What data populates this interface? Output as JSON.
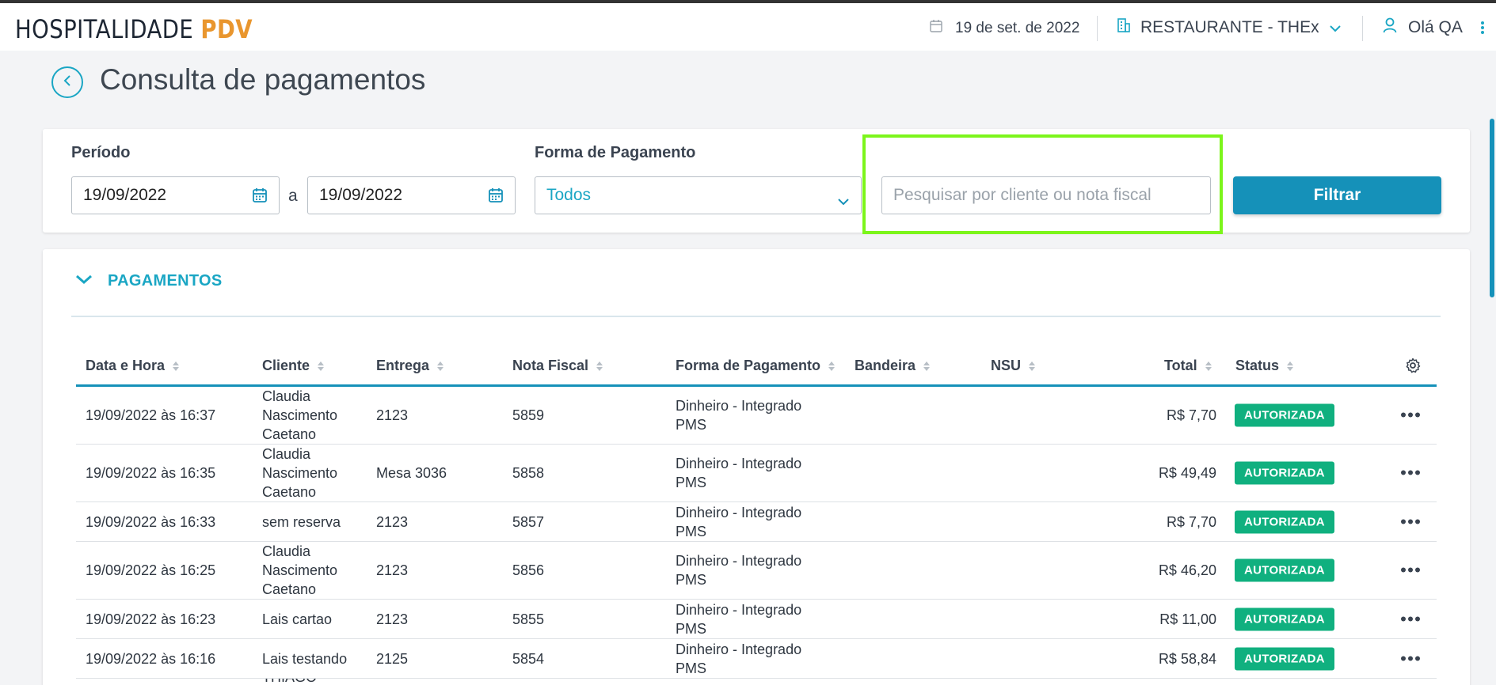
{
  "header": {
    "brand_main": "HOSPITALIDADE",
    "brand_accent": "PDV",
    "date": "19 de set. de 2022",
    "restaurant": "RESTAURANTE - THEx",
    "greeting": "Olá QA"
  },
  "page": {
    "title": "Consulta de pagamentos"
  },
  "filters": {
    "period_label": "Período",
    "date_from": "19/09/2022",
    "date_sep": "a",
    "date_to": "19/09/2022",
    "payment_label": "Forma de Pagamento",
    "payment_value": "Todos",
    "search_placeholder": "Pesquisar por cliente ou nota fiscal",
    "search_value": "",
    "filter_button": "Filtrar"
  },
  "payments": {
    "section_title": "PAGAMENTOS",
    "columns": [
      "Data e Hora",
      "Cliente",
      "Entrega",
      "Nota Fiscal",
      "Forma de Pagamento",
      "Bandeira",
      "NSU",
      "Total",
      "Status"
    ],
    "rows": [
      {
        "datetime": "19/09/2022 às 16:37",
        "client": "Claudia Nascimento Caetano",
        "delivery": "2123",
        "invoice": "5859",
        "payment": "Dinheiro - Integrado PMS",
        "brand": "",
        "nsu": "",
        "total": "R$ 7,70",
        "status": "AUTORIZADA"
      },
      {
        "datetime": "19/09/2022 às 16:35",
        "client": "Claudia Nascimento Caetano",
        "delivery": "Mesa 3036",
        "invoice": "5858",
        "payment": "Dinheiro - Integrado PMS",
        "brand": "",
        "nsu": "",
        "total": "R$ 49,49",
        "status": "AUTORIZADA"
      },
      {
        "datetime": "19/09/2022 às 16:33",
        "client": "sem reserva",
        "delivery": "2123",
        "invoice": "5857",
        "payment": "Dinheiro - Integrado PMS",
        "brand": "",
        "nsu": "",
        "total": "R$ 7,70",
        "status": "AUTORIZADA"
      },
      {
        "datetime": "19/09/2022 às 16:25",
        "client": "Claudia Nascimento Caetano",
        "delivery": "2123",
        "invoice": "5856",
        "payment": "Dinheiro - Integrado PMS",
        "brand": "",
        "nsu": "",
        "total": "R$ 46,20",
        "status": "AUTORIZADA"
      },
      {
        "datetime": "19/09/2022 às 16:23",
        "client": "Lais cartao",
        "delivery": "2123",
        "invoice": "5855",
        "payment": "Dinheiro - Integrado PMS",
        "brand": "",
        "nsu": "",
        "total": "R$ 11,00",
        "status": "AUTORIZADA"
      },
      {
        "datetime": "19/09/2022 às 16:16",
        "client": "Lais testando",
        "delivery": "2125",
        "invoice": "5854",
        "payment": "Dinheiro - Integrado PMS",
        "brand": "",
        "nsu": "",
        "total": "R$ 58,84",
        "status": "AUTORIZADA"
      },
      {
        "datetime": "",
        "client": "THIAGO",
        "delivery": "",
        "invoice": "",
        "payment": "",
        "brand": "",
        "nsu": "",
        "total": "",
        "status": ""
      }
    ]
  },
  "colors": {
    "accent": "#1aa6c4",
    "primary_button": "#1591b9",
    "brand_orange": "#e9962e",
    "status_green": "#10b07f",
    "highlight": "#7cf51b"
  }
}
